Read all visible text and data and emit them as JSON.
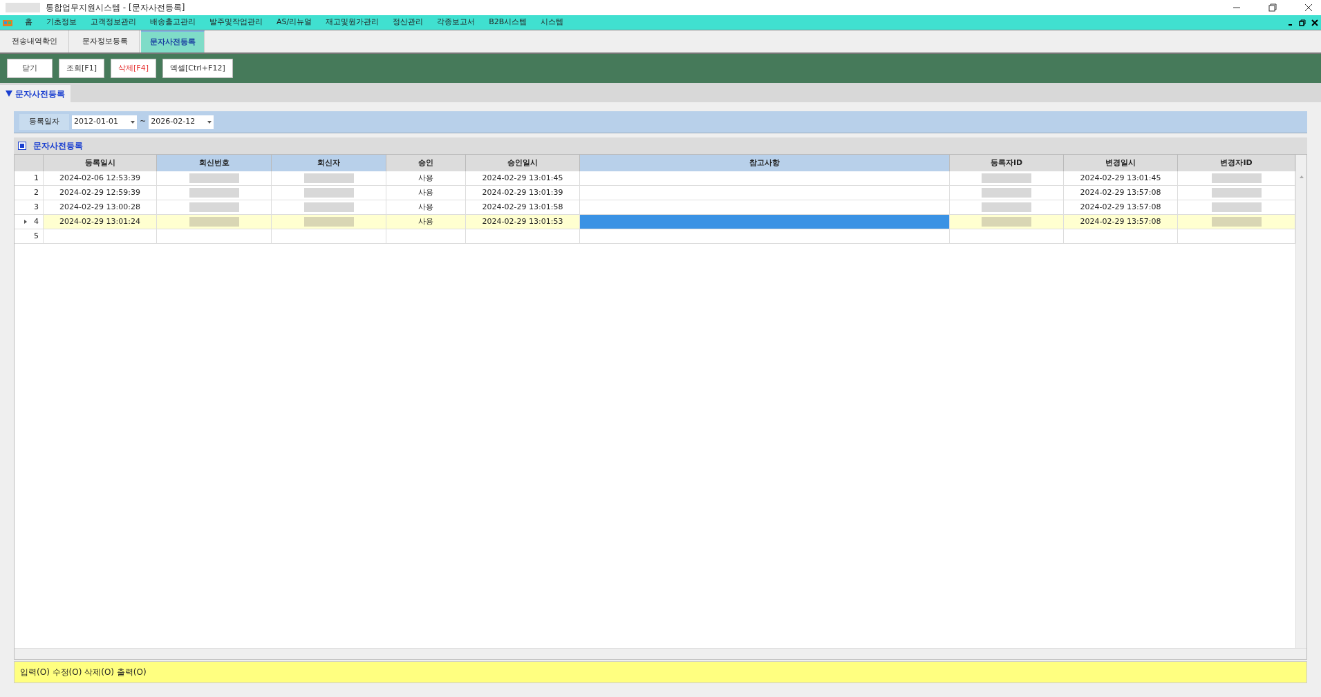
{
  "window": {
    "title": "통합업무지원시스템 - [문자사전등록]"
  },
  "menu": [
    "홈",
    "기초정보",
    "고객정보관리",
    "배송출고관리",
    "발주및작업관리",
    "AS/리뉴얼",
    "재고및원가관리",
    "정산관리",
    "각종보고서",
    "B2B시스템",
    "시스템"
  ],
  "tabs": [
    {
      "label": "전송내역확인",
      "selected": false
    },
    {
      "label": "문자정보등록",
      "selected": false
    },
    {
      "label": "문자사전등록",
      "selected": true
    }
  ],
  "toolbar": [
    {
      "label": "닫기",
      "kind": "normal"
    },
    {
      "label": "조회[F1]",
      "kind": "normal"
    },
    {
      "label": "삭제[F4]",
      "kind": "danger"
    },
    {
      "label": "엑셀[Ctrl+F12]",
      "kind": "normal"
    }
  ],
  "section": {
    "title": "문자사전등록",
    "expanded": true
  },
  "filter": {
    "label": "등록일자",
    "from": "2012-01-01",
    "separator": "~",
    "to": "2026-02-12"
  },
  "grid": {
    "title": "문자사전등록",
    "columns": [
      {
        "label": "등록일시",
        "kind": "text",
        "editable": false
      },
      {
        "label": "회신번호",
        "kind": "redacted",
        "editable": true
      },
      {
        "label": "회신자",
        "kind": "redacted",
        "editable": true
      },
      {
        "label": "승인",
        "kind": "text",
        "editable": false
      },
      {
        "label": "승인일시",
        "kind": "text",
        "editable": false
      },
      {
        "label": "참고사항",
        "kind": "text",
        "editable": true
      },
      {
        "label": "등록자ID",
        "kind": "redacted",
        "editable": false
      },
      {
        "label": "변경일시",
        "kind": "text",
        "editable": false
      },
      {
        "label": "변경자ID",
        "kind": "redacted",
        "editable": false
      }
    ],
    "rows": [
      {
        "number": "1",
        "selected": false,
        "cells": [
          "2024-02-06 12:53:39",
          "사용",
          "2024-02-29 13:01:45",
          "2024-02-29 13:01:45"
        ]
      },
      {
        "number": "2",
        "selected": false,
        "cells": [
          "2024-02-29 12:59:39",
          "사용",
          "2024-02-29 13:01:39",
          "2024-02-29 13:57:08"
        ]
      },
      {
        "number": "3",
        "selected": false,
        "cells": [
          "2024-02-29 13:00:28",
          "사용",
          "2024-02-29 13:01:58",
          "2024-02-29 13:57:08"
        ]
      },
      {
        "number": "4",
        "selected": true,
        "cells": [
          "2024-02-29 13:01:24",
          "사용",
          "2024-02-29 13:01:53",
          "2024-02-29 13:57:08"
        ]
      },
      {
        "number": "5",
        "selected": false
      }
    ]
  },
  "status_bar": "입력(O) 수정(O) 삭제(O) 출력(O)"
}
